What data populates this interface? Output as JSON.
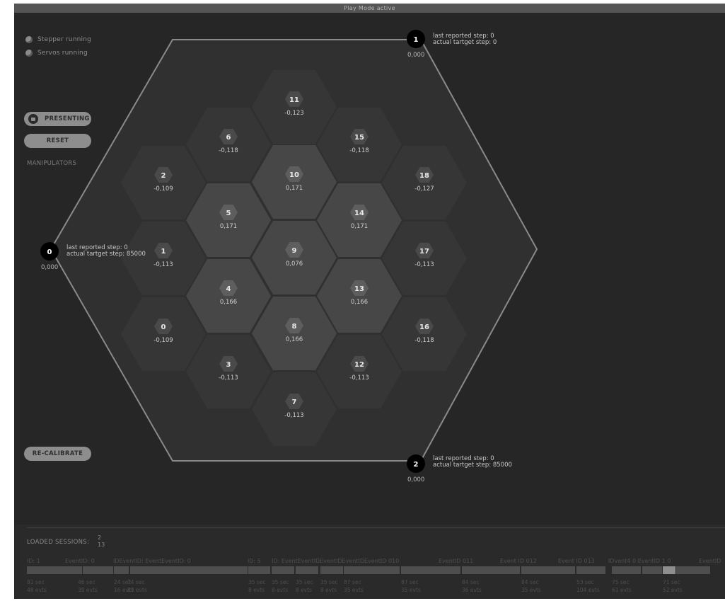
{
  "title_bar": "Play Mode active",
  "status": {
    "stepper": "Stepper running",
    "servos": "Servos running"
  },
  "buttons": {
    "presenting": "PRESENTING",
    "reset": "RESET",
    "recalibrate": "RE-CALIBRATE"
  },
  "manipulators_label": "MANIPULATORS",
  "hexes": [
    {
      "id": "0",
      "value": "-0,109"
    },
    {
      "id": "1",
      "value": "-0,113"
    },
    {
      "id": "2",
      "value": "-0,109"
    },
    {
      "id": "3",
      "value": "-0,113"
    },
    {
      "id": "4",
      "value": "0,166"
    },
    {
      "id": "5",
      "value": "0,171"
    },
    {
      "id": "6",
      "value": "-0,118"
    },
    {
      "id": "7",
      "value": "-0,113"
    },
    {
      "id": "8",
      "value": "0,166"
    },
    {
      "id": "9",
      "value": "0,076"
    },
    {
      "id": "10",
      "value": "0,171"
    },
    {
      "id": "11",
      "value": "-0,123"
    },
    {
      "id": "12",
      "value": "-0,113"
    },
    {
      "id": "13",
      "value": "0,166"
    },
    {
      "id": "14",
      "value": "0,171"
    },
    {
      "id": "15",
      "value": "-0,118"
    },
    {
      "id": "16",
      "value": "-0,118"
    },
    {
      "id": "17",
      "value": "-0,113"
    },
    {
      "id": "18",
      "value": "-0,127"
    }
  ],
  "corners": [
    {
      "id": "0",
      "value": "0,000",
      "reported": "last reported step:  0",
      "target": "actual tartget step: 85000"
    },
    {
      "id": "1",
      "value": "0,000",
      "reported": "last reported step:  0",
      "target": "actual tartget step: 0"
    },
    {
      "id": "2",
      "value": "0,000",
      "reported": "last reported step:  0",
      "target": "actual tartget step: 85000"
    }
  ],
  "sessions": {
    "label": "LOADED SESSIONS:",
    "values": [
      "2",
      "13"
    ],
    "event_labels": [
      {
        "text": "ID: 1"
      },
      {
        "text": "EventID: 0"
      },
      {
        "text": "IDEventID: EventEventID: 0"
      },
      {
        "text": "ID: 5"
      },
      {
        "text": "ID: EventEventIDEventIDEventIDEventID 010"
      },
      {
        "text": "EventID 011"
      },
      {
        "text": "Event ID 012"
      },
      {
        "text": "Event ID 013"
      },
      {
        "text": "IDvent4 0  EventID 1 0"
      },
      {
        "text": "EventID"
      }
    ],
    "bars": [
      {
        "highlight": false
      },
      {
        "highlight": false
      },
      {
        "highlight": false
      },
      {
        "highlight": false
      },
      {
        "highlight": false
      },
      {
        "highlight": false
      },
      {
        "highlight": false
      },
      {
        "highlight": false
      },
      {
        "highlight": false
      },
      {
        "highlight": false
      },
      {
        "highlight": false
      },
      {
        "highlight": false
      },
      {
        "highlight": false
      },
      {
        "highlight": false
      },
      {
        "highlight": false
      },
      {
        "highlight": false
      },
      {
        "highlight": false
      },
      {
        "highlight": true
      },
      {
        "highlight": false
      }
    ],
    "durations": [
      {
        "sec": "81 sec",
        "evts": "48 evts"
      },
      {
        "sec": "46 sec",
        "evts": "39 evts"
      },
      {
        "sec": "24 sec",
        "evts": "16 evts"
      },
      {
        "sec": "74 sec",
        "evts": "89 evts"
      },
      {
        "sec": "35 sec",
        "evts": "8 evts"
      },
      {
        "sec": "35 sec",
        "evts": "8 evts"
      },
      {
        "sec": "35 sec",
        "evts": "8 evts"
      },
      {
        "sec": "35 sec",
        "evts": "8 evts"
      },
      {
        "sec": "87 sec",
        "evts": "35 evts"
      },
      {
        "sec": "87 sec",
        "evts": "35 evts"
      },
      {
        "sec": "84 sec",
        "evts": "36 evts"
      },
      {
        "sec": "84 sec",
        "evts": "35 evts"
      },
      {
        "sec": "53 sec",
        "evts": "104 evts"
      },
      {
        "sec": "75 sec",
        "evts": "61 evts"
      },
      {
        "sec": "71 sec",
        "evts": "52 evts"
      }
    ]
  }
}
